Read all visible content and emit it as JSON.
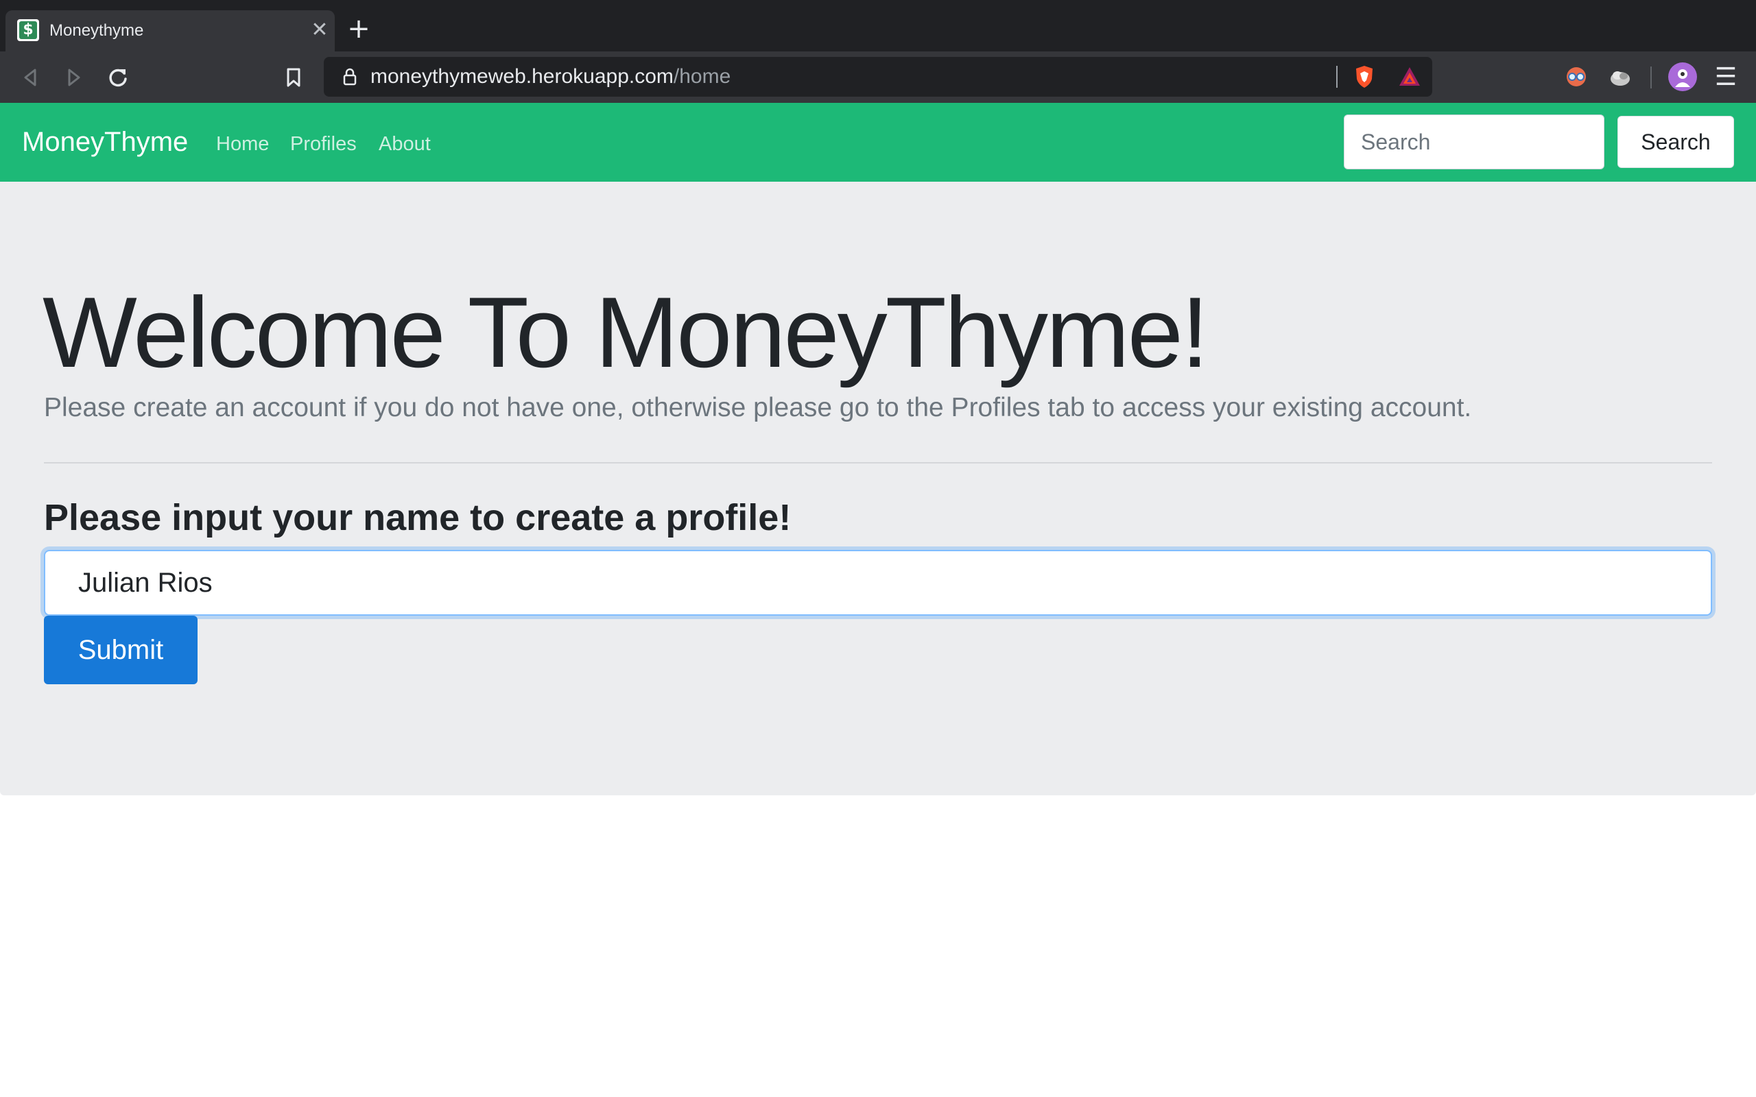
{
  "browser": {
    "tab_title": "Moneythyme",
    "favicon_glyph": "$",
    "close_glyph": "✕",
    "new_tab_glyph": "+",
    "menu_glyph": "☰",
    "url_host": "moneythymeweb.herokuapp.com",
    "url_path": "/home"
  },
  "navbar": {
    "brand": "MoneyThyme",
    "links": [
      "Home",
      "Profiles",
      "About"
    ],
    "search_placeholder": "Search",
    "search_button": "Search",
    "bg_color": "#1db977"
  },
  "main": {
    "title": "Welcome To MoneyThyme!",
    "lead": "Please create an account if you do not have one, otherwise please go to the Profiles tab to access your existing account.",
    "form_label": "Please input your name to create a profile!",
    "name_value": "Julian Rios",
    "submit_label": "Submit",
    "submit_color": "#1779d8"
  }
}
